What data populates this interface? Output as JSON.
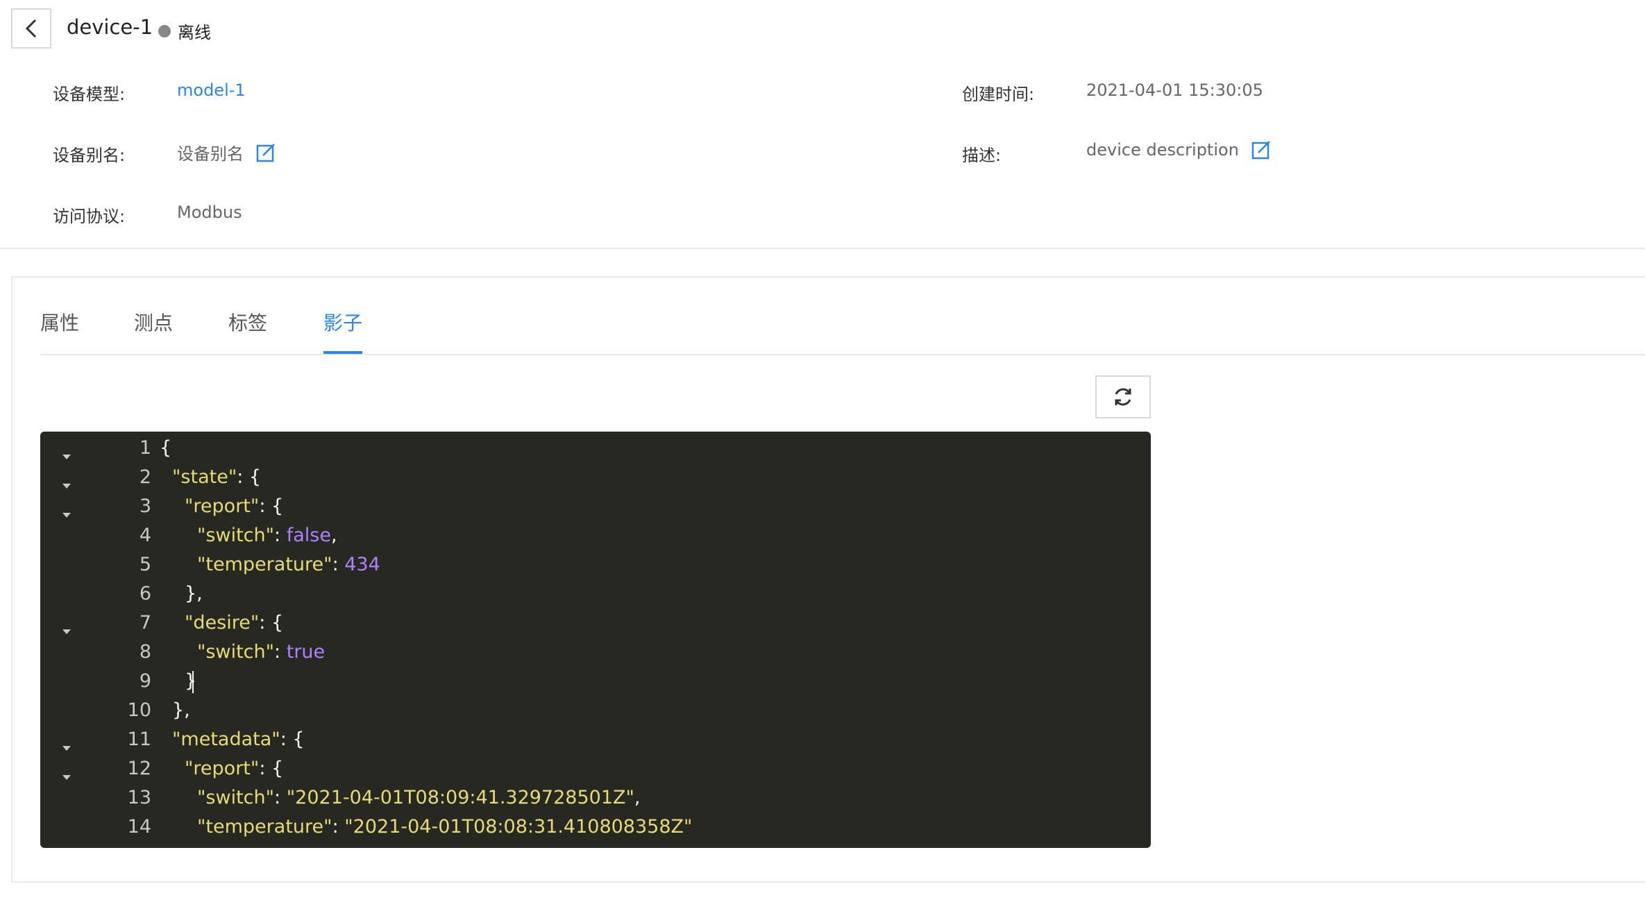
{
  "device": {
    "title": "device-1",
    "status": "离线"
  },
  "info": {
    "model_label": "设备模型:",
    "model_value": "model-1",
    "alias_label": "设备别名:",
    "alias_value": "设备别名",
    "protocol_label": "访问协议:",
    "protocol_value": "Modbus",
    "created_label": "创建时间:",
    "created_value": "2021-04-01 15:30:05",
    "desc_label": "描述:",
    "desc_value": "device description"
  },
  "tabs": [
    {
      "label": "属性"
    },
    {
      "label": "测点"
    },
    {
      "label": "标签"
    },
    {
      "label": "影子",
      "active": true
    }
  ],
  "editor": {
    "lines": [
      {
        "n": "1",
        "fold": true,
        "indent": 0,
        "key": "",
        "after": "{"
      },
      {
        "n": "2",
        "fold": true,
        "indent": 1,
        "key": "\"state\"",
        "after": ": {"
      },
      {
        "n": "3",
        "fold": true,
        "indent": 2,
        "key": "\"report\"",
        "after": ": {"
      },
      {
        "n": "4",
        "fold": false,
        "indent": 3,
        "key": "\"switch\"",
        "after": ": ",
        "val": "false",
        "vtype": "b",
        "tail": ","
      },
      {
        "n": "5",
        "fold": false,
        "indent": 3,
        "key": "\"temperature\"",
        "after": ": ",
        "val": "434",
        "vtype": "n",
        "tail": ""
      },
      {
        "n": "6",
        "fold": false,
        "indent": 2,
        "key": "",
        "after": "},"
      },
      {
        "n": "7",
        "fold": true,
        "indent": 2,
        "key": "\"desire\"",
        "after": ": {"
      },
      {
        "n": "8",
        "fold": false,
        "indent": 3,
        "key": "\"switch\"",
        "after": ": ",
        "val": "true",
        "vtype": "b",
        "tail": ""
      },
      {
        "n": "9",
        "fold": false,
        "indent": 2,
        "key": "",
        "after": "}",
        "cursor": true
      },
      {
        "n": "10",
        "fold": false,
        "indent": 1,
        "key": "",
        "after": "},"
      },
      {
        "n": "11",
        "fold": true,
        "indent": 1,
        "key": "\"metadata\"",
        "after": ": {"
      },
      {
        "n": "12",
        "fold": true,
        "indent": 2,
        "key": "\"report\"",
        "after": ": {"
      },
      {
        "n": "13",
        "fold": false,
        "indent": 3,
        "key": "\"switch\"",
        "after": ": ",
        "val": "\"2021-04-01T08:09:41.329728501Z\"",
        "vtype": "s",
        "tail": ","
      },
      {
        "n": "14",
        "fold": false,
        "indent": 3,
        "key": "\"temperature\"",
        "after": ": ",
        "val": "\"2021-04-01T08:08:31.410808358Z\"",
        "vtype": "s",
        "tail": ""
      }
    ]
  },
  "colors": {
    "accent": "#2b85e4",
    "editor_bg": "#272822",
    "status_offline": "#888888"
  },
  "icons": {
    "back": "chevron-left-icon",
    "edit": "edit-icon",
    "refresh": "refresh-icon",
    "fold": "caret-down-icon"
  }
}
